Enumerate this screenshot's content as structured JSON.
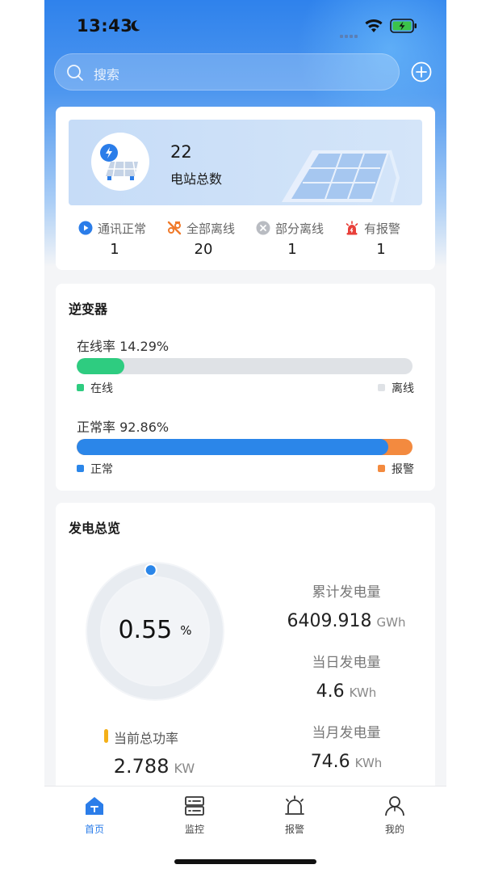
{
  "status_bar": {
    "time": "13:43"
  },
  "search": {
    "placeholder": "搜索"
  },
  "summary": {
    "station_count": "22",
    "station_label": "电站总数",
    "stats": [
      {
        "label": "通讯正常",
        "value": "1",
        "icon": "play-circle-icon",
        "color": "#2b7de9"
      },
      {
        "label": "全部离线",
        "value": "20",
        "icon": "offline-icon",
        "color": "#f07a2a"
      },
      {
        "label": "部分离线",
        "value": "1",
        "icon": "x-circle-icon",
        "color": "#b9bcc2"
      },
      {
        "label": "有报警",
        "value": "1",
        "icon": "alarm-light-icon",
        "color": "#e8403a"
      }
    ]
  },
  "inverter": {
    "title": "逆变器",
    "online_rate_label": "在线率 14.29%",
    "online_rate": 14.29,
    "online_legend": "在线",
    "offline_legend": "离线",
    "normal_rate_label": "正常率 92.86%",
    "normal_rate": 92.86,
    "normal_legend": "正常",
    "alarm_legend": "报警",
    "colors": {
      "online": "#2ecc80",
      "offline": "#dfe2e6",
      "normal": "#2b86e9",
      "alarm": "#f38a3f"
    }
  },
  "generation": {
    "title": "发电总览",
    "gauge_value": "0.55",
    "gauge_unit": "%",
    "gauge_percent": 0.55,
    "current_power_label": "当前总功率",
    "current_power_value": "2.788",
    "current_power_unit": "KW",
    "total_label": "累计发电量",
    "total_value": "6409.918",
    "total_unit": "GWh",
    "daily_label": "当日发电量",
    "daily_value": "4.6",
    "daily_unit": "KWh",
    "monthly_label": "当月发电量",
    "monthly_value": "74.6",
    "monthly_unit": "KWh"
  },
  "tabs": [
    {
      "label": "首页",
      "icon": "home-icon",
      "active": true
    },
    {
      "label": "监控",
      "icon": "server-icon",
      "active": false
    },
    {
      "label": "报警",
      "icon": "alarm-bell-icon",
      "active": false
    },
    {
      "label": "我的",
      "icon": "user-icon",
      "active": false
    }
  ]
}
